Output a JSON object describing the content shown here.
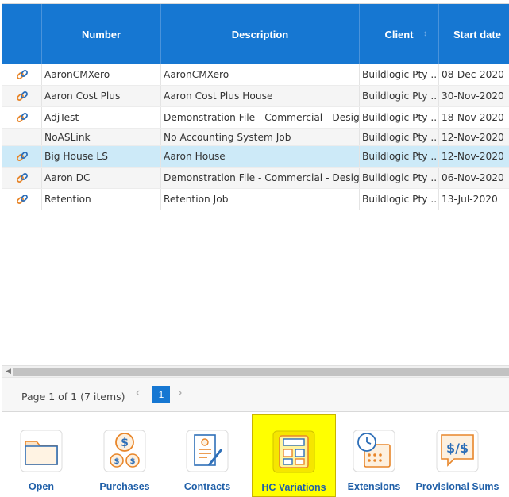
{
  "grid": {
    "columns": [
      {
        "label": ""
      },
      {
        "label": "Number"
      },
      {
        "label": "Description"
      },
      {
        "label": "Client"
      },
      {
        "label": "Start date"
      }
    ],
    "rows": [
      {
        "number": "AaronCMXero",
        "description": "AaronCMXero",
        "client": "Buildlogic Pty ...",
        "start": "08-Dec-2020",
        "linked": true
      },
      {
        "number": "Aaron Cost Plus",
        "description": "Aaron Cost Plus House",
        "client": "Buildlogic Pty ...",
        "start": "30-Nov-2020",
        "linked": true
      },
      {
        "number": "AdjTest",
        "description": "Demonstration File - Commercial - Desig...",
        "client": "Buildlogic Pty ...",
        "start": "18-Nov-2020",
        "linked": true
      },
      {
        "number": "NoASLink",
        "description": "No Accounting System Job",
        "client": "Buildlogic Pty ...",
        "start": "12-Nov-2020",
        "linked": false
      },
      {
        "number": "Big House LS",
        "description": "Aaron House",
        "client": "Buildlogic Pty ...",
        "start": "12-Nov-2020",
        "linked": true,
        "selected": true
      },
      {
        "number": "Aaron DC",
        "description": "Demonstration File - Commercial - Desig...",
        "client": "Buildlogic Pty ...",
        "start": "06-Nov-2020",
        "linked": true
      },
      {
        "number": "Retention",
        "description": "Retention Job",
        "client": "Buildlogic Pty ...",
        "start": "13-Jul-2020",
        "linked": true
      }
    ]
  },
  "pager": {
    "info": "Page 1 of 1 (7 items)",
    "current_page": "1",
    "prev": "‹",
    "next": "›"
  },
  "toolbar": {
    "items": [
      {
        "label": "Open",
        "icon": "folder-icon"
      },
      {
        "label": "Purchases",
        "icon": "coins-icon"
      },
      {
        "label": "Contracts",
        "icon": "contract-icon"
      },
      {
        "label": "HC Variations",
        "icon": "calculator-icon",
        "highlighted": true
      },
      {
        "label": "Extensions",
        "icon": "calendar-clock-icon"
      },
      {
        "label": "Provisional Sums",
        "icon": "money-bubble-icon"
      }
    ]
  },
  "colors": {
    "header": "#1677d2",
    "selected_row": "#cdeaf8",
    "highlight": "#ffff00",
    "link_icon": "#e8862a",
    "toolbar_label": "#1f5fa8"
  }
}
